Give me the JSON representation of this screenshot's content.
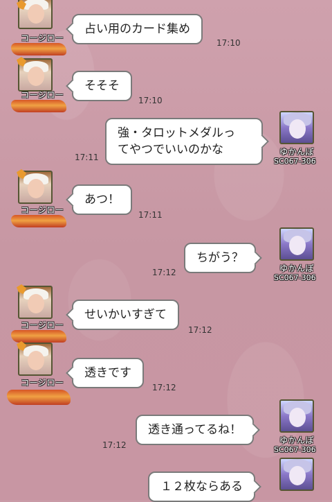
{
  "names": {
    "koji": "コージロー",
    "yuka": "ゆかんぼ",
    "yuka_code": "SC067-306"
  },
  "messages": [
    {
      "side": "left",
      "text": "占い用のカード集め",
      "time": "17:10"
    },
    {
      "side": "left",
      "text": "そそそ",
      "time": "17:10"
    },
    {
      "side": "right",
      "text_lines": [
        "強・タロットメダルっ",
        "てやつでいいのかな"
      ],
      "time": "17:11"
    },
    {
      "side": "left",
      "text": "あつ！",
      "time": "17:11"
    },
    {
      "side": "right",
      "text": "ちがう？",
      "time": "17:12"
    },
    {
      "side": "left",
      "text": "せいかいすぎて",
      "time": "17:12"
    },
    {
      "side": "left",
      "text": "透きです",
      "time": "17:12"
    },
    {
      "side": "right",
      "text": "透き通ってるね！",
      "time": "17:12"
    },
    {
      "side": "right",
      "text": "１２枚ならある",
      "time": ""
    }
  ],
  "colors": {
    "background": "#c99aa6",
    "bubble": "#ffffff",
    "bubble_border": "#7a7a7a"
  }
}
